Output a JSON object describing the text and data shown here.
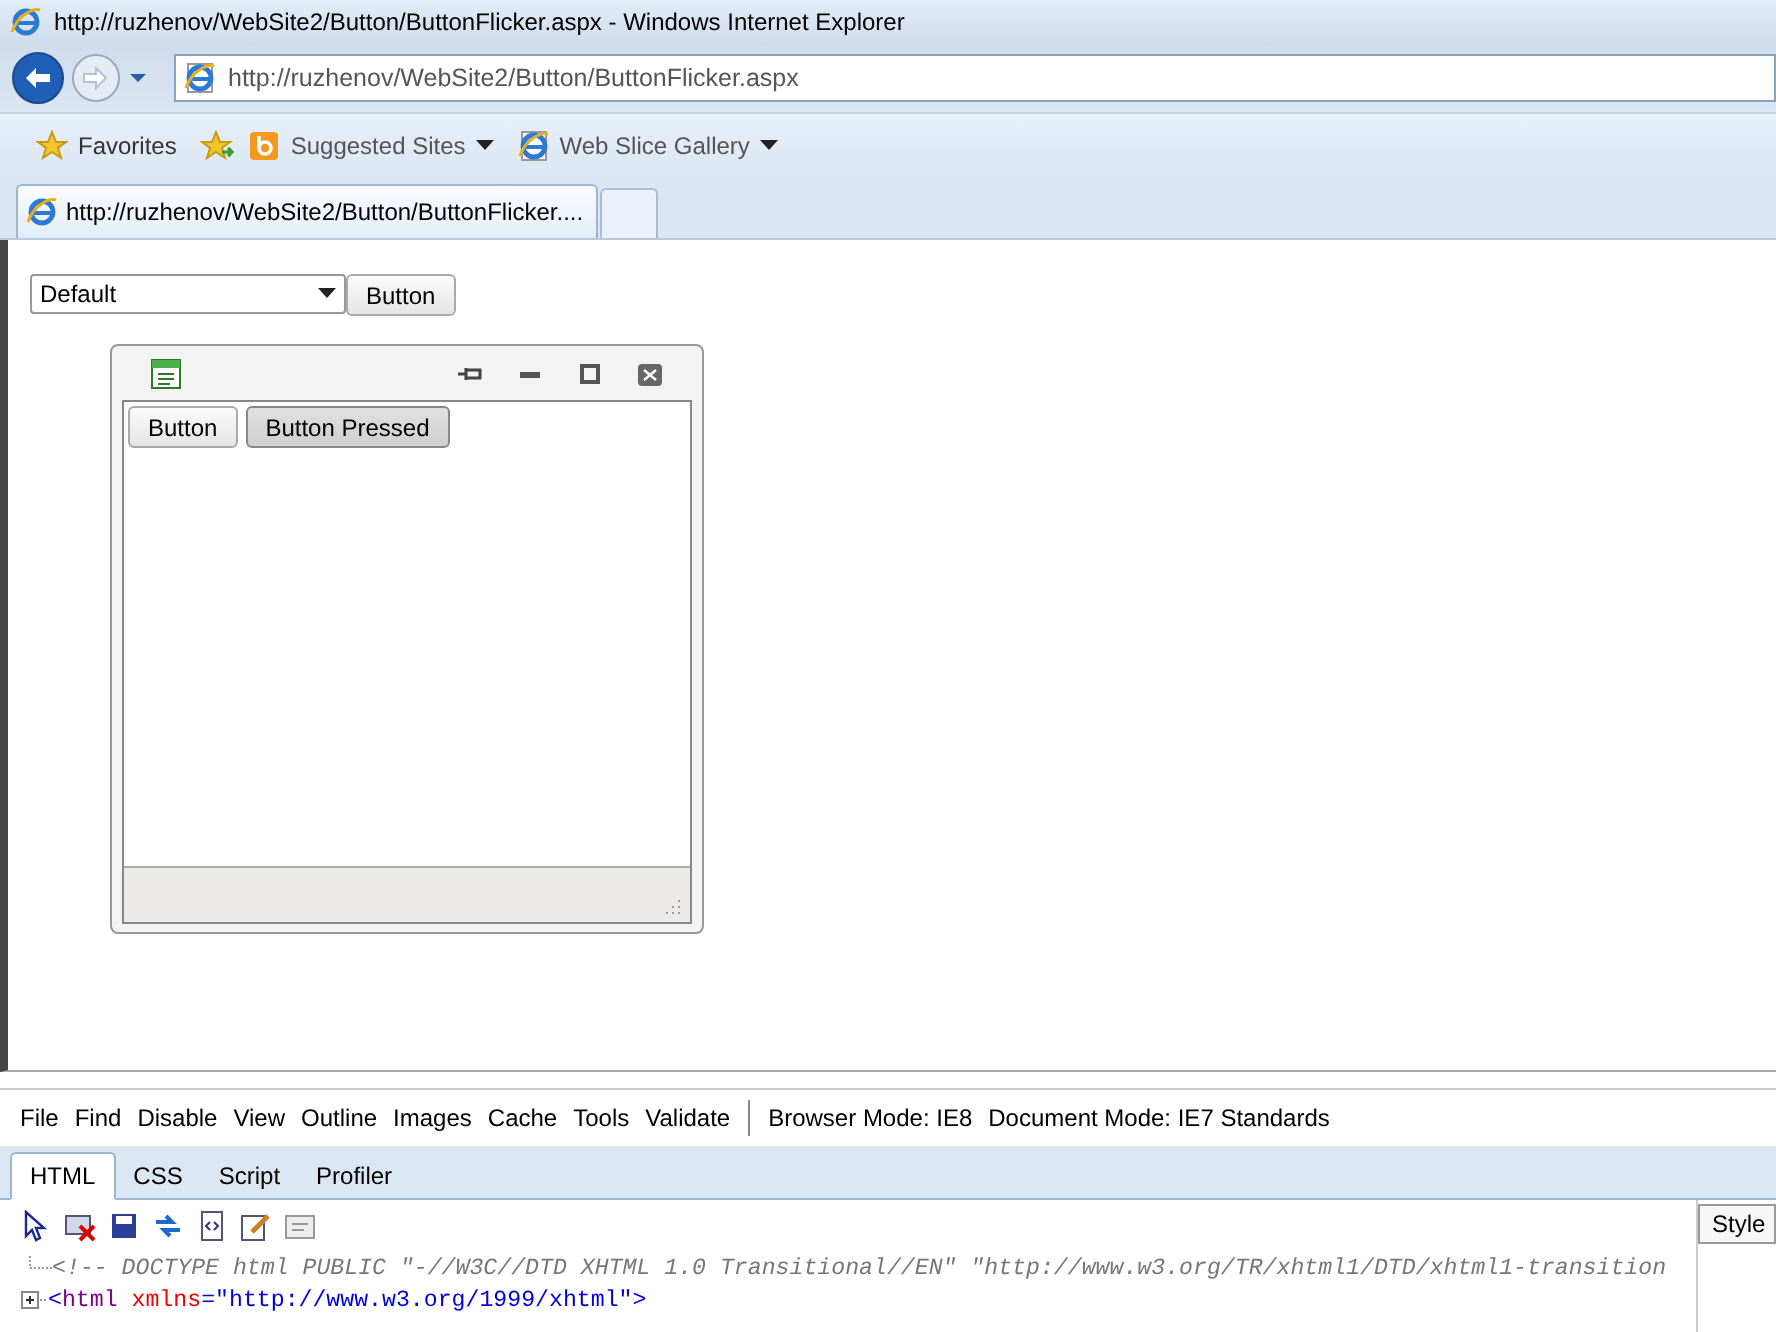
{
  "browser": {
    "title": "http://ruzhenov/WebSite2/Button/ButtonFlicker.aspx - Windows Internet Explorer",
    "address": "http://ruzhenov/WebSite2/Button/ButtonFlicker.aspx",
    "favorites_bar": [
      {
        "kind": "favorites",
        "label": "Favorites"
      },
      {
        "kind": "add"
      },
      {
        "kind": "suggested",
        "label": "Suggested Sites"
      },
      {
        "kind": "slice",
        "label": "Web Slice Gallery"
      }
    ],
    "tabs": [
      {
        "label": "http://ruzhenov/WebSite2/Button/ButtonFlicker....",
        "selected": true
      }
    ]
  },
  "page": {
    "select": {
      "value": "Default"
    },
    "button": "Button",
    "window": {
      "buttons": [
        {
          "label": "Button",
          "pressed": false
        },
        {
          "label": "Button Pressed",
          "pressed": true
        }
      ]
    }
  },
  "devtools": {
    "menu": [
      "File",
      "Find",
      "Disable",
      "View",
      "Outline",
      "Images",
      "Cache",
      "Tools",
      "Validate"
    ],
    "modes": [
      "Browser Mode: IE8",
      "Document Mode: IE7 Standards"
    ],
    "tabs": [
      {
        "label": "HTML",
        "selected": true
      },
      {
        "label": "CSS",
        "selected": false
      },
      {
        "label": "Script",
        "selected": false
      },
      {
        "label": "Profiler",
        "selected": false
      }
    ],
    "side_tab": "Style",
    "source": [
      {
        "kind": "comment",
        "parts": [
          {
            "kind": "comment",
            "text": "<!-- DOCTYPE html PUBLIC \"-//W3C//DTD XHTML 1.0 Transitional//EN\" \"http://www.w3.org/TR/xhtml1/DTD/xhtml1-transition"
          }
        ]
      },
      {
        "kind": "element",
        "parts": [
          {
            "kind": "punct",
            "text": "<"
          },
          {
            "kind": "tag",
            "text": "html"
          },
          {
            "kind": "attr",
            "text": " xmlns"
          },
          {
            "kind": "punct",
            "text": "=\""
          },
          {
            "kind": "value",
            "text": "http://www.w3.org/1999/xhtml"
          },
          {
            "kind": "punct",
            "text": "\">"
          }
        ]
      }
    ]
  }
}
